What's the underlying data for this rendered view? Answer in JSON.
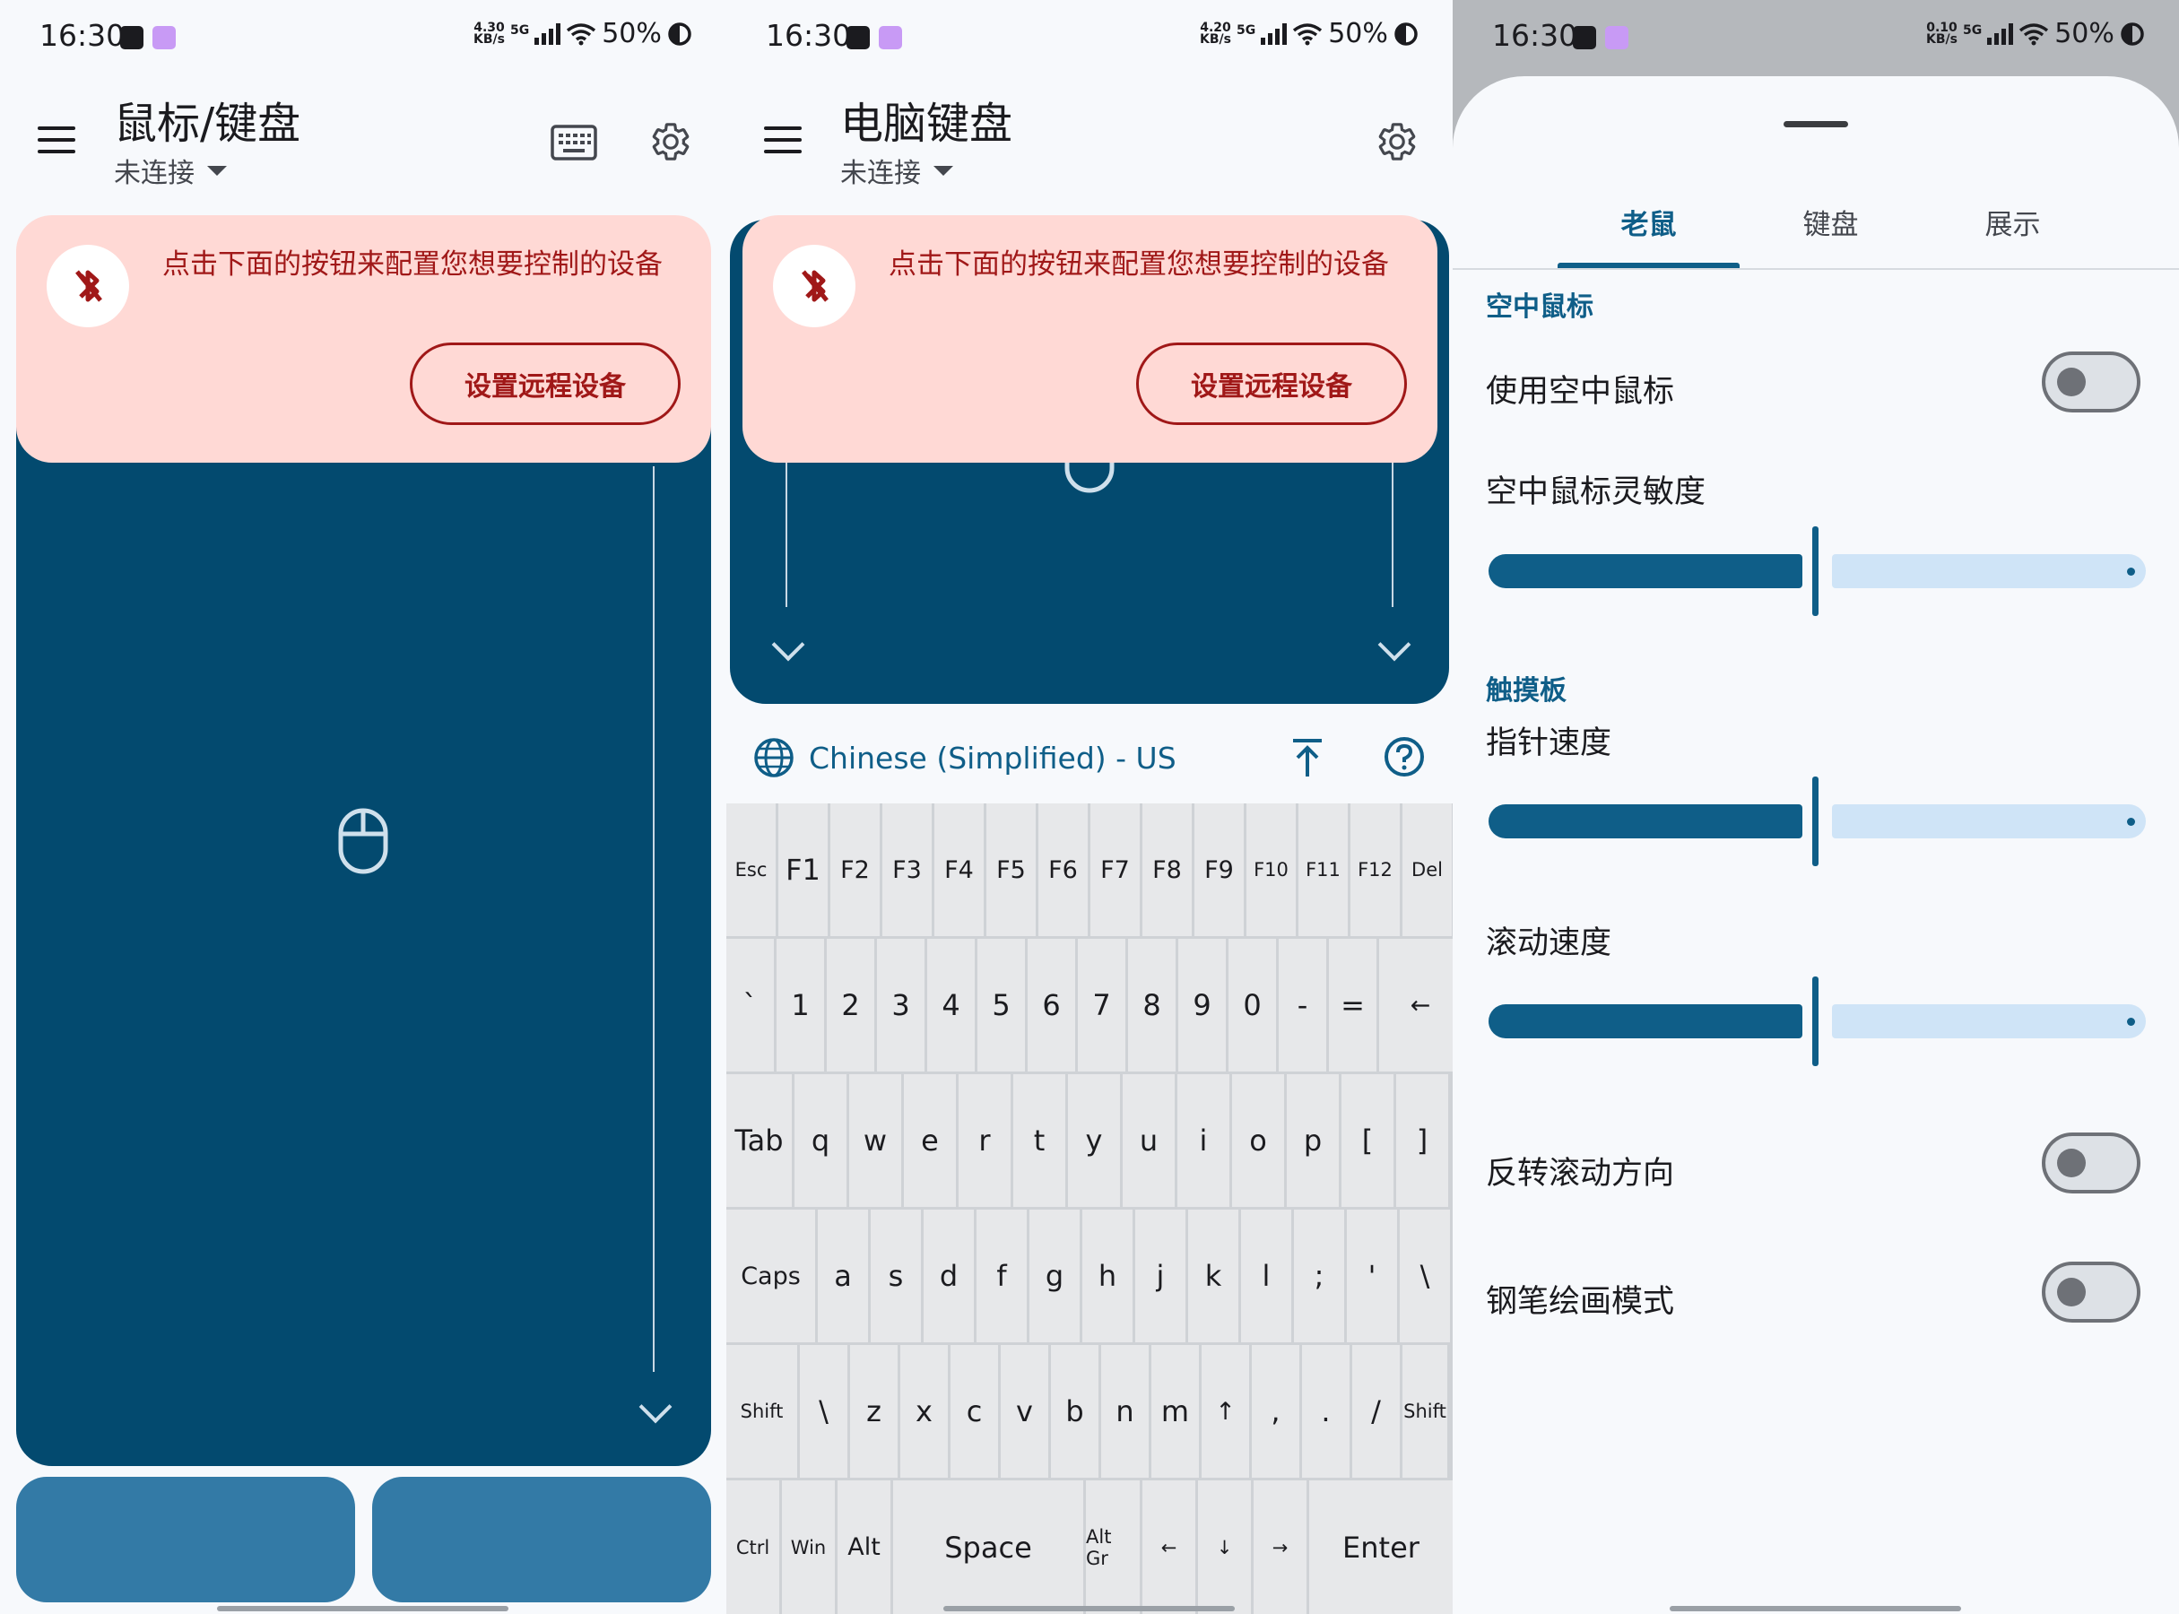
{
  "status_bars": [
    {
      "time": "16:30",
      "speed_value": "4.30",
      "speed_unit": "KB/s",
      "network": "5G",
      "battery": "50%"
    },
    {
      "time": "16:30",
      "speed_value": "4.20",
      "speed_unit": "KB/s",
      "network": "5G",
      "battery": "50%"
    },
    {
      "time": "16:30",
      "speed_value": "0.10",
      "speed_unit": "KB/s",
      "network": "5G",
      "battery": "50%"
    }
  ],
  "panel1": {
    "title": "鼠标/键盘",
    "subtitle": "未连接",
    "banner": {
      "message": "点击下面的按钮来配置您想要控制的设备",
      "button": "设置远程设备"
    }
  },
  "panel2": {
    "title": "电脑键盘",
    "subtitle": "未连接",
    "banner": {
      "message": "点击下面的按钮来配置您想要控制的设备",
      "button": "设置远程设备"
    },
    "keyboard_language": "Chinese (Simplified) - US",
    "keyboard_rows": [
      [
        "Esc",
        "F1",
        "F2",
        "F3",
        "F4",
        "F5",
        "F6",
        "F7",
        "F8",
        "F9",
        "F10",
        "F11",
        "F12",
        "Del"
      ],
      [
        "`",
        "1",
        "2",
        "3",
        "4",
        "5",
        "6",
        "7",
        "8",
        "9",
        "0",
        "-",
        "=",
        "←"
      ],
      [
        "Tab",
        "q",
        "w",
        "e",
        "r",
        "t",
        "y",
        "u",
        "i",
        "o",
        "p",
        "[",
        "]"
      ],
      [
        "Caps",
        "a",
        "s",
        "d",
        "f",
        "g",
        "h",
        "j",
        "k",
        "l",
        ";",
        "'",
        "\\"
      ],
      [
        "Shift",
        "\\",
        "z",
        "x",
        "c",
        "v",
        "b",
        "n",
        "m",
        "↑",
        ",",
        ".",
        "/",
        "Shift"
      ],
      [
        "Ctrl",
        "Win",
        "Alt",
        "Space",
        "Alt Gr",
        "←",
        "↓",
        "→",
        "Enter"
      ]
    ]
  },
  "panel3": {
    "tabs": [
      "老鼠",
      "键盘",
      "展示"
    ],
    "active_tab": "老鼠",
    "section_air": "空中鼠标",
    "use_air_mouse": {
      "label": "使用空中鼠标",
      "on": false
    },
    "air_sensitivity": {
      "label": "空中鼠标灵敏度",
      "value": 0.5
    },
    "section_touchpad": "触摸板",
    "pointer_speed": {
      "label": "指针速度",
      "value": 0.5
    },
    "scroll_speed": {
      "label": "滚动速度",
      "value": 0.5
    },
    "invert_scroll": {
      "label": "反转滚动方向",
      "on": false
    },
    "pen_mode": {
      "label": "钢笔绘画模式",
      "on": false
    }
  },
  "colors": {
    "primary": "#0f5e88",
    "touchpad": "#034a6f",
    "mouse_button": "#337aa6",
    "banner_bg": "#ffd9d5",
    "banner_text": "#a01818",
    "slider_inactive": "#cfe4f7"
  }
}
